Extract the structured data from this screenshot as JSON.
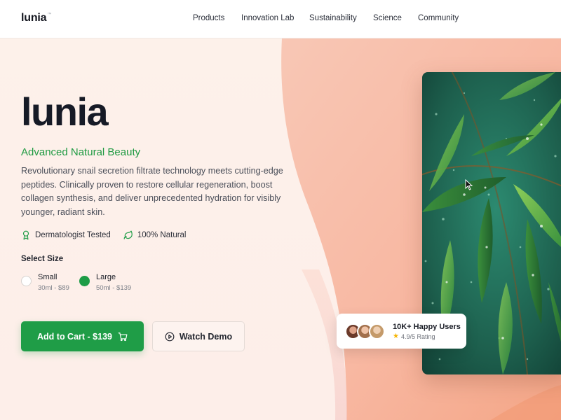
{
  "header": {
    "logo": "lunia",
    "logo_mark": "™",
    "nav": [
      "Products",
      "Innovation Lab",
      "Sustainability",
      "Science",
      "Community"
    ]
  },
  "hero": {
    "title": "lunia",
    "subtitle": "Advanced Natural Beauty",
    "description": "Revolutionary snail secretion filtrate technology meets cutting-edge peptides. Clinically proven to restore cellular regeneration, boost collagen synthesis, and deliver unprecedented hydration for visibly younger, radiant skin.",
    "badges": [
      {
        "icon": "award-icon",
        "label": "Dermatologist Tested"
      },
      {
        "icon": "leaf-icon",
        "label": "100% Natural"
      }
    ],
    "size_label": "Select Size",
    "sizes": [
      {
        "name": "Small",
        "detail": "30ml - $89",
        "selected": false
      },
      {
        "name": "Large",
        "detail": "50ml - $139",
        "selected": true
      }
    ],
    "cart_button": "Add to Cart - $139",
    "demo_button": "Watch Demo"
  },
  "social_proof": {
    "title": "10K+ Happy Users",
    "rating": "4.9/5 Rating"
  },
  "colors": {
    "accent": "#1f9d47",
    "text": "#161a26",
    "peach": "#f7b8a0"
  }
}
